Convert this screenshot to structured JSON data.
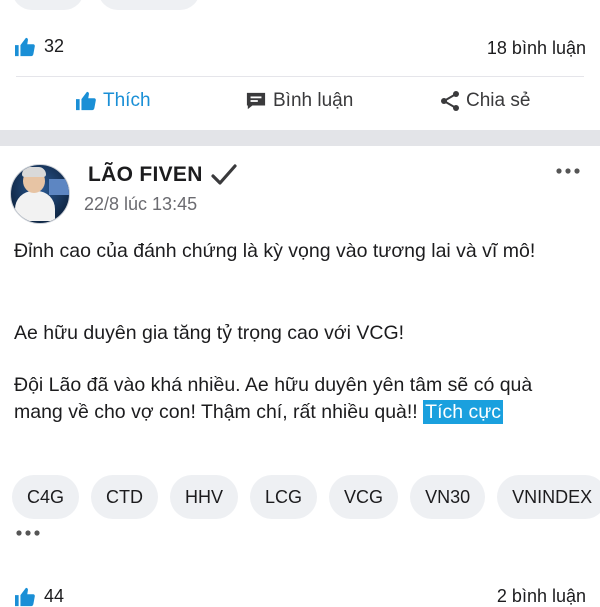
{
  "previous_post": {
    "like_count": "32",
    "comment_count": "18 bình luận",
    "actions": {
      "like_label": "Thích",
      "comment_label": "Bình luận",
      "share_label": "Chia sẻ"
    }
  },
  "post": {
    "author": "LÃO FIVEN",
    "timestamp": "22/8 lúc 13:45",
    "more_icon": "more-horizontal-icon",
    "paragraphs": [
      "Đỉnh cao của đánh chứng là kỳ vọng vào tương lai và vĩ mô!",
      "Ae hữu duyên gia tăng tỷ trọng cao với VCG!",
      "Đội Lão đã vào khá nhiều. Ae hữu duyên yên tâm sẽ có quà mang về cho vợ con! Thậm chí, rất nhiều quà!!"
    ],
    "hashtag": "Tích cực",
    "tags": [
      "C4G",
      "CTD",
      "HHV",
      "LCG",
      "VCG",
      "VN30",
      "VNINDEX"
    ]
  },
  "next_stats": {
    "like_count": "44",
    "comment_count": "2 bình luận"
  },
  "colors": {
    "accent": "#1a8fd6",
    "hashtag_bg": "#1aa0de",
    "separator": "#e3e4e8",
    "chip_bg": "#eef0f3"
  }
}
